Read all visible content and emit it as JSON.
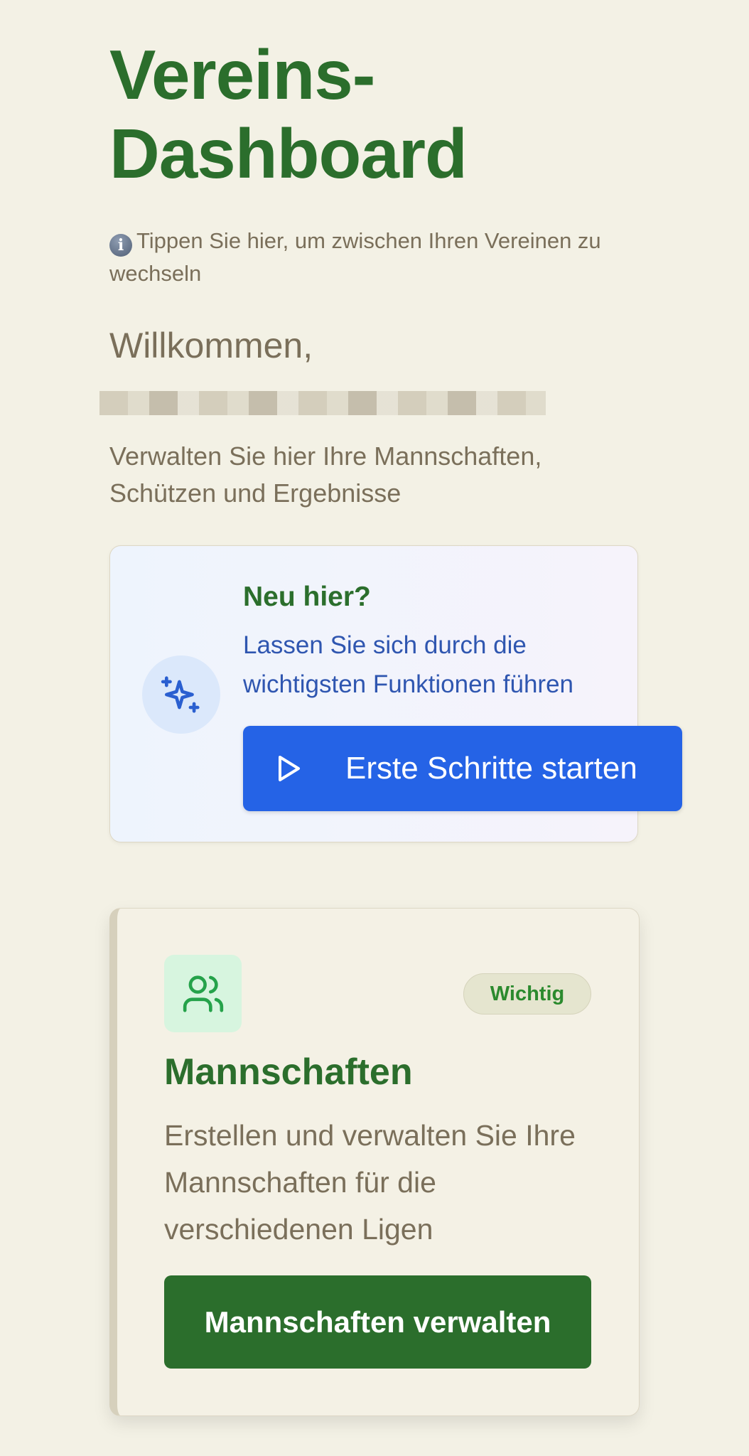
{
  "header": {
    "title_line1": "Vereins-",
    "title_line2": "Dashboard"
  },
  "club_switch_hint": "Tippen Sie hier, um zwischen Ihren Vereinen zu wechseln",
  "welcome": "Willkommen,",
  "subtitle": "Verwalten Sie hier Ihre Mannschaften, Schützen und Ergebnisse",
  "onboarding": {
    "title": "Neu hier?",
    "text": "Lassen Sie sich durch die wichtigsten Funktionen führen",
    "button": "Erste Schritte starten"
  },
  "teams_card": {
    "badge": "Wichtig",
    "title": "Mannschaften",
    "description": "Erstellen und verwalten Sie Ihre Mannschaften für die verschiedenen Ligen",
    "button": "Mannschaften verwalten"
  },
  "colors": {
    "background": "#f3f1e5",
    "green": "#2b6e2c",
    "blue": "#2563e6"
  }
}
